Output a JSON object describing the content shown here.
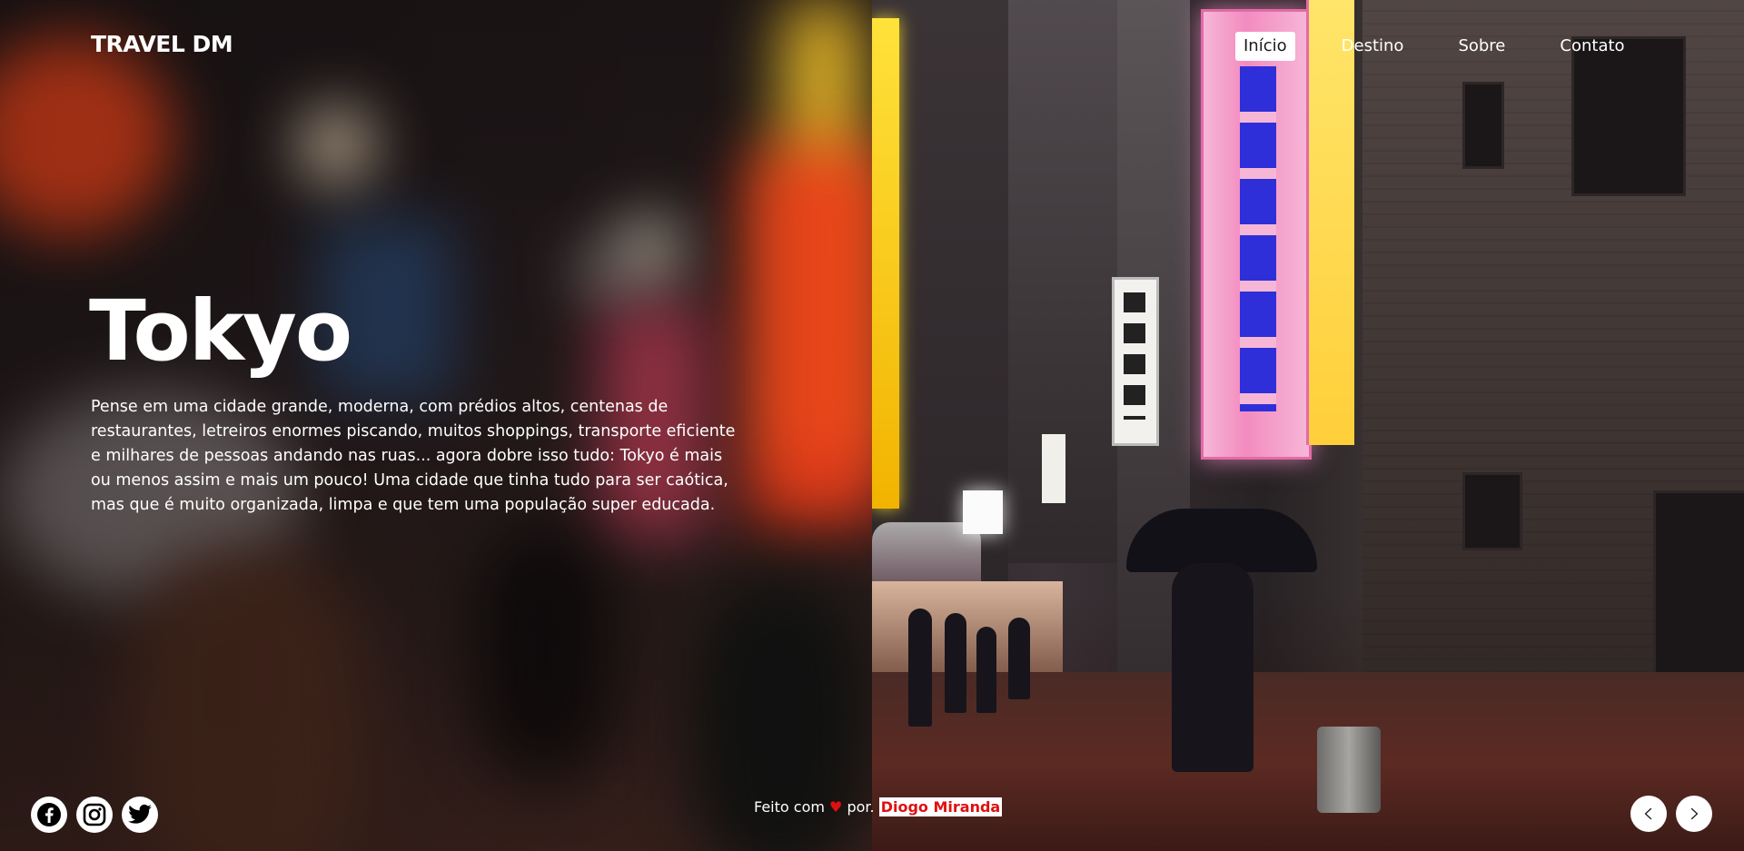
{
  "header": {
    "logo": "TRAVEL DM",
    "nav": [
      {
        "label": "Início",
        "active": true
      },
      {
        "label": "Destino",
        "active": false
      },
      {
        "label": "Sobre",
        "active": false
      },
      {
        "label": "Contato",
        "active": false
      }
    ]
  },
  "hero": {
    "title": "Tokyo",
    "description": "Pense em uma cidade grande, moderna, com prédios altos, centenas de restaurantes, letreiros enormes piscando, muitos shoppings, transporte eficiente e milhares de pessoas andando nas ruas... agora dobre isso tudo: Tokyo é mais ou menos assim e mais um pouco! Uma cidade que tinha tudo para ser caótica, mas que é muito organizada, limpa e que tem uma população super educada."
  },
  "footer": {
    "social": [
      {
        "icon": "facebook-icon"
      },
      {
        "icon": "instagram-icon"
      },
      {
        "icon": "twitter-icon"
      }
    ],
    "credit_prefix": "Feito com",
    "credit_heart": "♥",
    "credit_middle": "por",
    "credit_author": "Diogo Miranda",
    "arrows": [
      {
        "icon": "chevron-left-icon"
      },
      {
        "icon": "chevron-right-icon"
      }
    ]
  },
  "colors": {
    "accent_red": "#e01010",
    "nav_active_bg": "#ffffff",
    "text": "#ffffff"
  }
}
